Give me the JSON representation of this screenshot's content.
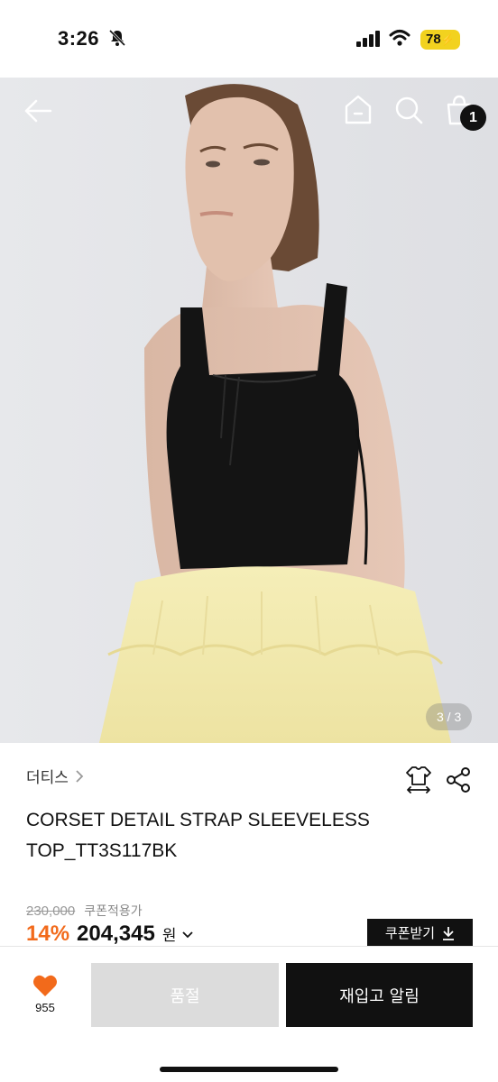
{
  "status_bar": {
    "time": "3:26",
    "battery": "78",
    "icons": [
      "bell-off-icon",
      "signal-icon",
      "wifi-icon",
      "battery-icon"
    ]
  },
  "header": {
    "icons": [
      "back-arrow-icon",
      "home-icon",
      "search-icon",
      "shopping-bag-icon"
    ],
    "cart_count": "1"
  },
  "gallery": {
    "counter": "3 / 3",
    "colors": {
      "top": "#141414",
      "skirt": "#f3eab0",
      "wall": "#e9eaed"
    }
  },
  "product": {
    "brand": "더티스",
    "title_line1": "CORSET DETAIL STRAP SLEEVELESS",
    "title_line2": "TOP_TT3S117BK",
    "original_price": "230,000",
    "coupon_note": "쿠폰적용가",
    "discount": "14%",
    "sale_price": "204,345",
    "currency": "원",
    "coupon_button": "쿠폰받기"
  },
  "bottom_bar": {
    "like_count": "955",
    "soldout_label": "품절",
    "restock_label": "재입고 알림"
  },
  "colors": {
    "accent": "#f26a1b",
    "dark": "#111111",
    "disabled": "#dcdcdc"
  }
}
